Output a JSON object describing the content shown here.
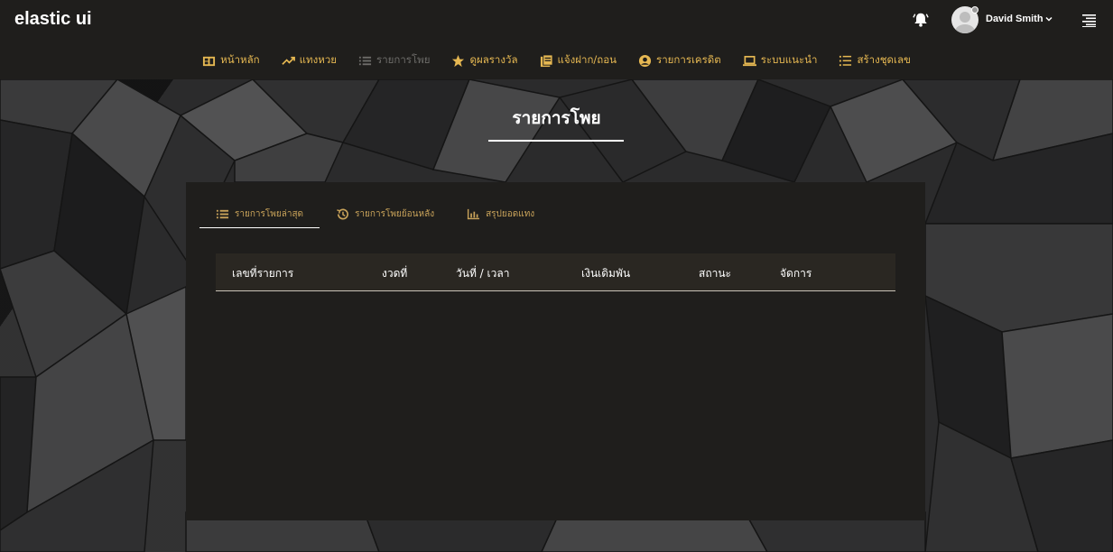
{
  "app": {
    "brand": "elastic ui"
  },
  "header": {
    "user_name": "David Smith",
    "icons": [
      "bell-icon",
      "avatar",
      "chevron-down-icon",
      "menu-icon"
    ]
  },
  "nav": {
    "items": [
      {
        "label": "หน้าหลัก",
        "icon": "home-icon",
        "active": false
      },
      {
        "label": "แทงหวย",
        "icon": "trending-up-icon",
        "active": false
      },
      {
        "label": "รายการโพย",
        "icon": "list-icon",
        "active": true
      },
      {
        "label": "ดูผลรางวัล",
        "icon": "star-icon",
        "active": false
      },
      {
        "label": "แจ้งฝาก/ถอน",
        "icon": "book-icon",
        "active": false
      },
      {
        "label": "รายการเครดิต",
        "icon": "user-circle-icon",
        "active": false
      },
      {
        "label": "ระบบแนะนำ",
        "icon": "laptop-icon",
        "active": false
      },
      {
        "label": "สร้างชุดเลข",
        "icon": "list-numbered-icon",
        "active": false
      }
    ]
  },
  "page": {
    "title": "รายการโพย"
  },
  "tabs": [
    {
      "label": "รายการโพยล่าสุด",
      "icon": "list-icon",
      "active": true
    },
    {
      "label": "รายการโพยย้อนหลัง",
      "icon": "history-icon",
      "active": false
    },
    {
      "label": "สรุปยอดแทง",
      "icon": "bar-chart-icon",
      "active": false
    }
  ],
  "table": {
    "columns": [
      "เลขที่รายการ",
      "งวดที่",
      "วันที่ / เวลา",
      "เงินเดิมพัน",
      "สถานะ",
      "จัดการ"
    ],
    "rows": []
  },
  "colors": {
    "accent": "#e6b852",
    "tab_text": "#c9a35a",
    "background": "#1f1e1c",
    "inactive_nav": "#6d6c69"
  }
}
